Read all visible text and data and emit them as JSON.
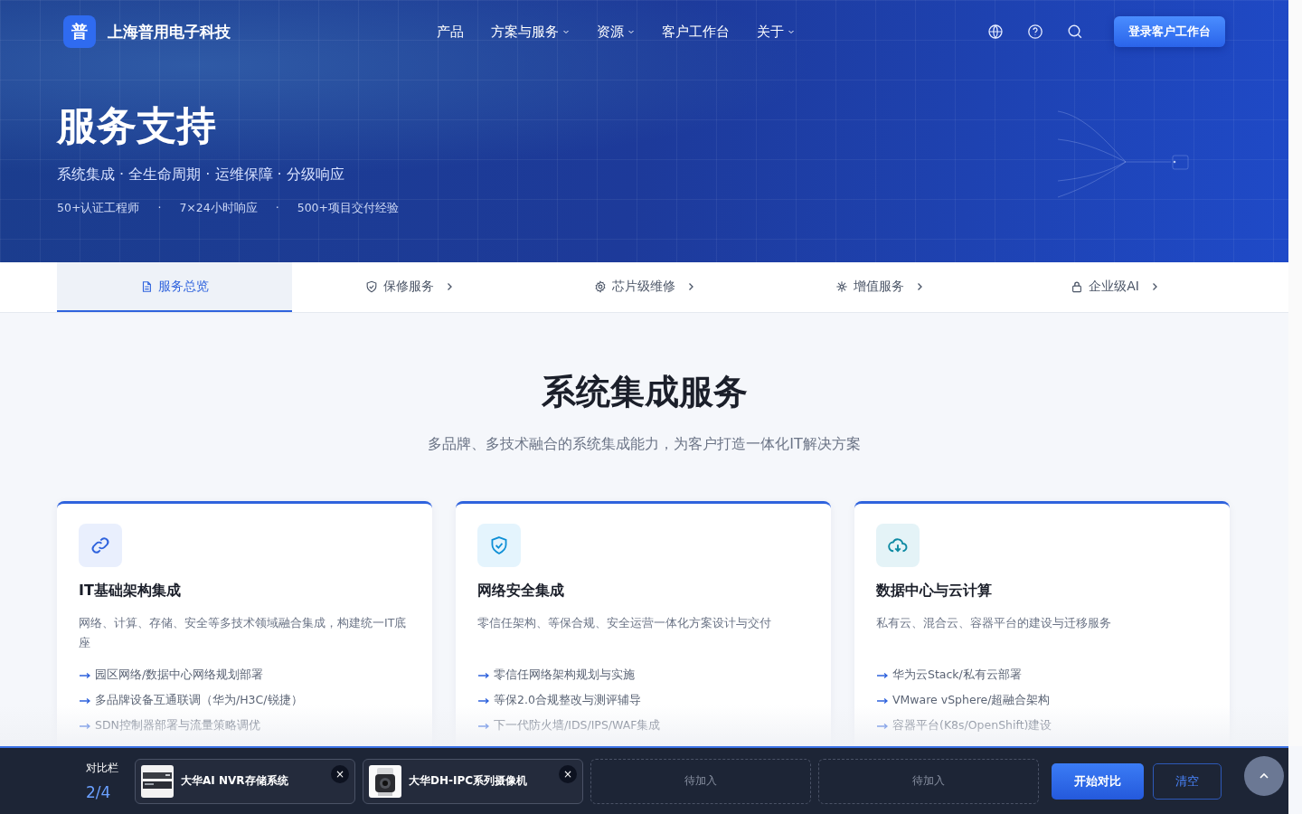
{
  "brand": {
    "logo": "普",
    "name": "上海普用电子科技"
  },
  "nav": [
    {
      "label": "产品",
      "dropdown": false
    },
    {
      "label": "方案与服务",
      "dropdown": true
    },
    {
      "label": "资源",
      "dropdown": true
    },
    {
      "label": "客户工作台",
      "dropdown": false
    },
    {
      "label": "关于",
      "dropdown": true
    }
  ],
  "login_button": "登录客户工作台",
  "hero": {
    "title": "服务支持",
    "subtitle": "系统集成 · 全生命周期 · 运维保障 · 分级响应",
    "stats": [
      "50+认证工程师",
      "7×24小时响应",
      "500+项目交付经验"
    ],
    "separator": "·"
  },
  "tabs": [
    {
      "label": "服务总览",
      "selected": true,
      "chevron": false
    },
    {
      "label": "保修服务",
      "selected": false,
      "chevron": true
    },
    {
      "label": "芯片级维修",
      "selected": false,
      "chevron": true
    },
    {
      "label": "增值服务",
      "selected": false,
      "chevron": true
    },
    {
      "label": "企业级AI",
      "selected": false,
      "chevron": true
    }
  ],
  "section": {
    "title": "系统集成服务",
    "subtitle": "多品牌、多技术融合的系统集成能力，为客户打造一体化IT解决方案"
  },
  "cards": [
    {
      "title": "IT基础架构集成",
      "description": "网络、计算、存储、安全等多技术领域融合集成，构建统一IT底座",
      "items": [
        "园区网络/数据中心网络规划部署",
        "多品牌设备互通联调（华为/H3C/锐捷）",
        "SDN控制器部署与流量策略调优"
      ]
    },
    {
      "title": "网络安全集成",
      "description": "零信任架构、等保合规、安全运营一体化方案设计与交付",
      "items": [
        "零信任网络架构规划与实施",
        "等保2.0合规整改与测评辅导",
        "下一代防火墙/IDS/IPS/WAF集成"
      ]
    },
    {
      "title": "数据中心与云计算",
      "description": "私有云、混合云、容器平台的建设与迁移服务",
      "items": [
        "华为云Stack/私有云部署",
        "VMware vSphere/超融合架构",
        "容器平台(K8s/OpenShift)建设"
      ]
    }
  ],
  "compare_bar": {
    "label": "对比栏",
    "count": "2/4",
    "slots": [
      {
        "kind": "item",
        "name": "大华AI NVR存储系统",
        "remove": "×"
      },
      {
        "kind": "item",
        "name": "大华DH-IPC系列摄像机",
        "remove": "×"
      },
      {
        "kind": "empty",
        "name": "待加入"
      },
      {
        "kind": "empty",
        "name": "待加入"
      }
    ],
    "start_button": "开始对比",
    "clear_button": "清空"
  }
}
